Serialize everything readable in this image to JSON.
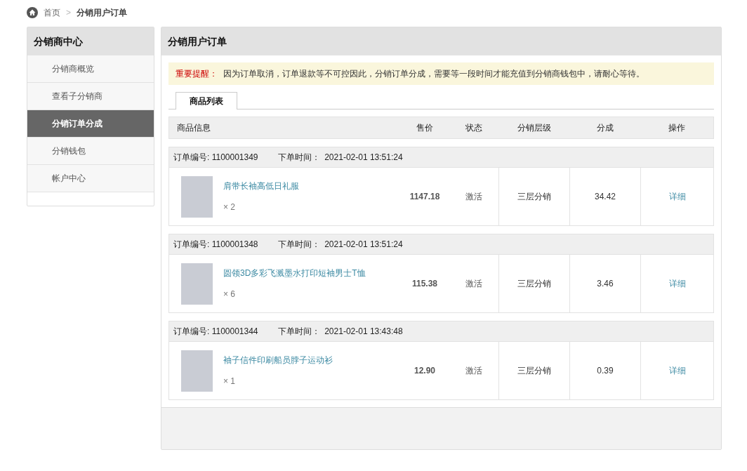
{
  "breadcrumb": {
    "items": [
      {
        "label": "首页",
        "current": false
      },
      {
        "label": "分销用户订单",
        "current": true
      }
    ],
    "separator": ">"
  },
  "sidebar": {
    "title": "分销商中心",
    "items": [
      {
        "label": "分销商概览",
        "selected": false
      },
      {
        "label": "查看子分销商",
        "selected": false
      },
      {
        "label": "分销订单分成",
        "selected": true
      },
      {
        "label": "分销钱包",
        "selected": false
      },
      {
        "label": "帐户中心",
        "selected": false
      }
    ]
  },
  "panel": {
    "title": "分销用户订单",
    "notice": {
      "label": "重要提醒：",
      "text": "因为订单取消，订单退款等不可控因此，分销订单分成，需要等一段时间才能充值到分销商钱包中，请耐心等待。"
    },
    "tabs": [
      {
        "label": "商品列表",
        "selected": true
      }
    ],
    "columns": [
      "商品信息",
      "售价",
      "状态",
      "分销层级",
      "分成",
      "操作"
    ],
    "orders": [
      {
        "number_label": "订单编号: 1100001349",
        "time_label": "下单时间：",
        "time": "2021-02-01 13:51:24",
        "product": "肩带长袖高低日礼服",
        "quantity": "× 2",
        "price": "1147.18",
        "status": "激活",
        "level": "三层分销",
        "commission": "34.42",
        "action": "详细"
      },
      {
        "number_label": "订单编号: 1100001348",
        "time_label": "下单时间：",
        "time": "2021-02-01 13:51:24",
        "product": "圆领3D多彩飞溅墨水打印短袖男士T恤",
        "quantity": "× 6",
        "price": "115.38",
        "status": "激活",
        "level": "三层分销",
        "commission": "3.46",
        "action": "详细"
      },
      {
        "number_label": "订单编号: 1100001344",
        "time_label": "下单时间：",
        "time": "2021-02-01 13:43:48",
        "product": "袖子信件印刷船员脖子运动衫",
        "quantity": "× 1",
        "price": "12.90",
        "status": "激活",
        "level": "三层分销",
        "commission": "0.39",
        "action": "详细"
      }
    ]
  }
}
